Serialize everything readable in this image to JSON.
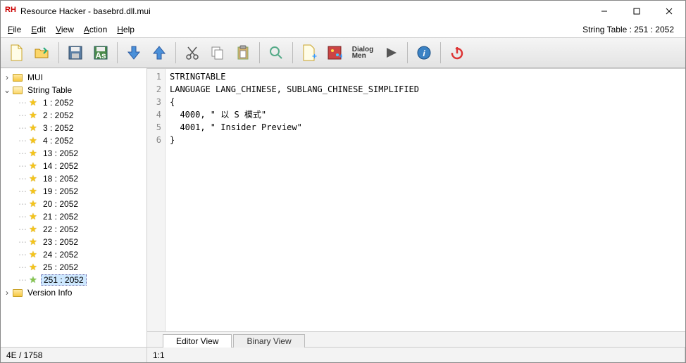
{
  "title": "Resource Hacker - basebrd.dll.mui",
  "app_icon_text": "RH",
  "menu": {
    "file": "File",
    "edit": "Edit",
    "view": "View",
    "action": "Action",
    "help": "Help"
  },
  "menubar_right": "String Table : 251 : 2052",
  "toolbar": {
    "dialog_label": "Dialog\nMen"
  },
  "tree": {
    "root1": {
      "label": "MUI"
    },
    "root2": {
      "label": "String Table"
    },
    "items": [
      {
        "label": "1 : 2052"
      },
      {
        "label": "2 : 2052"
      },
      {
        "label": "3 : 2052"
      },
      {
        "label": "4 : 2052"
      },
      {
        "label": "13 : 2052"
      },
      {
        "label": "14 : 2052"
      },
      {
        "label": "18 : 2052"
      },
      {
        "label": "19 : 2052"
      },
      {
        "label": "20 : 2052"
      },
      {
        "label": "21 : 2052"
      },
      {
        "label": "22 : 2052"
      },
      {
        "label": "23 : 2052"
      },
      {
        "label": "24 : 2052"
      },
      {
        "label": "25 : 2052"
      },
      {
        "label": "251 : 2052",
        "selected": true
      }
    ],
    "root3": {
      "label": "Version Info"
    }
  },
  "code_lines": [
    "STRINGTABLE",
    "LANGUAGE LANG_CHINESE, SUBLANG_CHINESE_SIMPLIFIED",
    "{",
    "  4000, \" 以 S 模式\"",
    "  4001, \" Insider Preview\"",
    "}"
  ],
  "tabs": {
    "editor": "Editor View",
    "binary": "Binary View"
  },
  "status": {
    "left": "4E / 1758",
    "pos": "1:1"
  }
}
